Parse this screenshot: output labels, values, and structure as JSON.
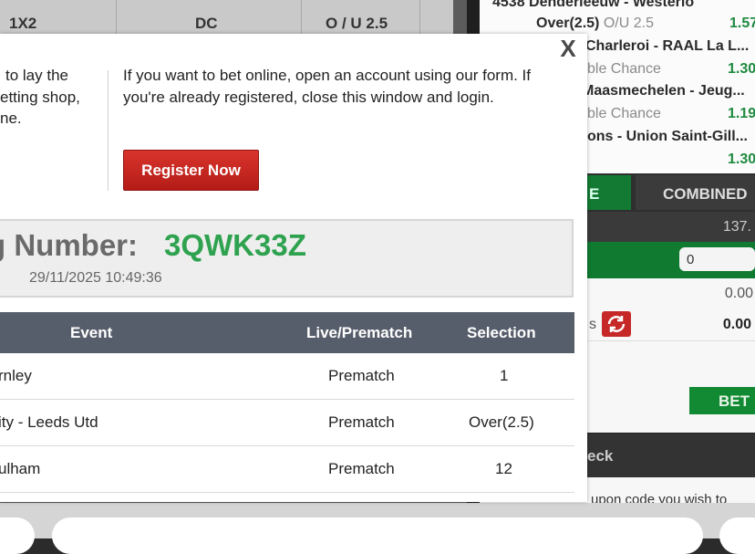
{
  "background": {
    "top_headers": [
      "1X2",
      "DC",
      "O / U 2.5"
    ],
    "bet_rows": [
      {
        "name": "4538  Denderleeuw - Westerlo",
        "market": "Over(2.5)",
        "market_extra": "O/U 2.5",
        "odd": "1.57"
      },
      {
        "name": "Charleroi - RAAL La L...",
        "market": "ble Chance",
        "odd": "1.30"
      },
      {
        "name": "Maasmechelen - Jeug...",
        "market": "ble Chance",
        "odd": "1.19"
      },
      {
        "name": "ons - Union Saint-Gill...",
        "market": "",
        "odd": "1.30"
      }
    ],
    "tab_single": "E",
    "tab_combined": "COMBINED",
    "total_odds": "137.",
    "stake_value": "0",
    "line1_value": "0.00",
    "line2_label": "s",
    "line2_value": "0.00",
    "bet_button": "BET",
    "check_label": "eck",
    "coupon_text": "upon code you wish to"
  },
  "modal": {
    "close_label": "X",
    "left_text": [
      "to lay the",
      "etting shop,",
      "ne."
    ],
    "right_text": [
      "If you want to bet online, open an account using our form. If",
      "you're already registered, close this window and login."
    ],
    "register_label": "Register Now",
    "booking_label": "g Number:",
    "booking_code": "3QWK33Z",
    "booking_date": "29/11/2025 10:49:36",
    "table": {
      "headers": [
        "Event",
        "Live/Prematch",
        "Selection"
      ],
      "rows": [
        {
          "event": "rnley",
          "type": "Prematch",
          "selection": "1"
        },
        {
          "event": "ity - Leeds Utd",
          "type": "Prematch",
          "selection": "Over(2.5)"
        },
        {
          "event": "ulham",
          "type": "Prematch",
          "selection": "12"
        }
      ]
    }
  },
  "colors": {
    "register_red": "#c62828",
    "code_green": "#2ea24f",
    "table_header": "#575e6b",
    "odd_green": "#1f8a3f"
  }
}
